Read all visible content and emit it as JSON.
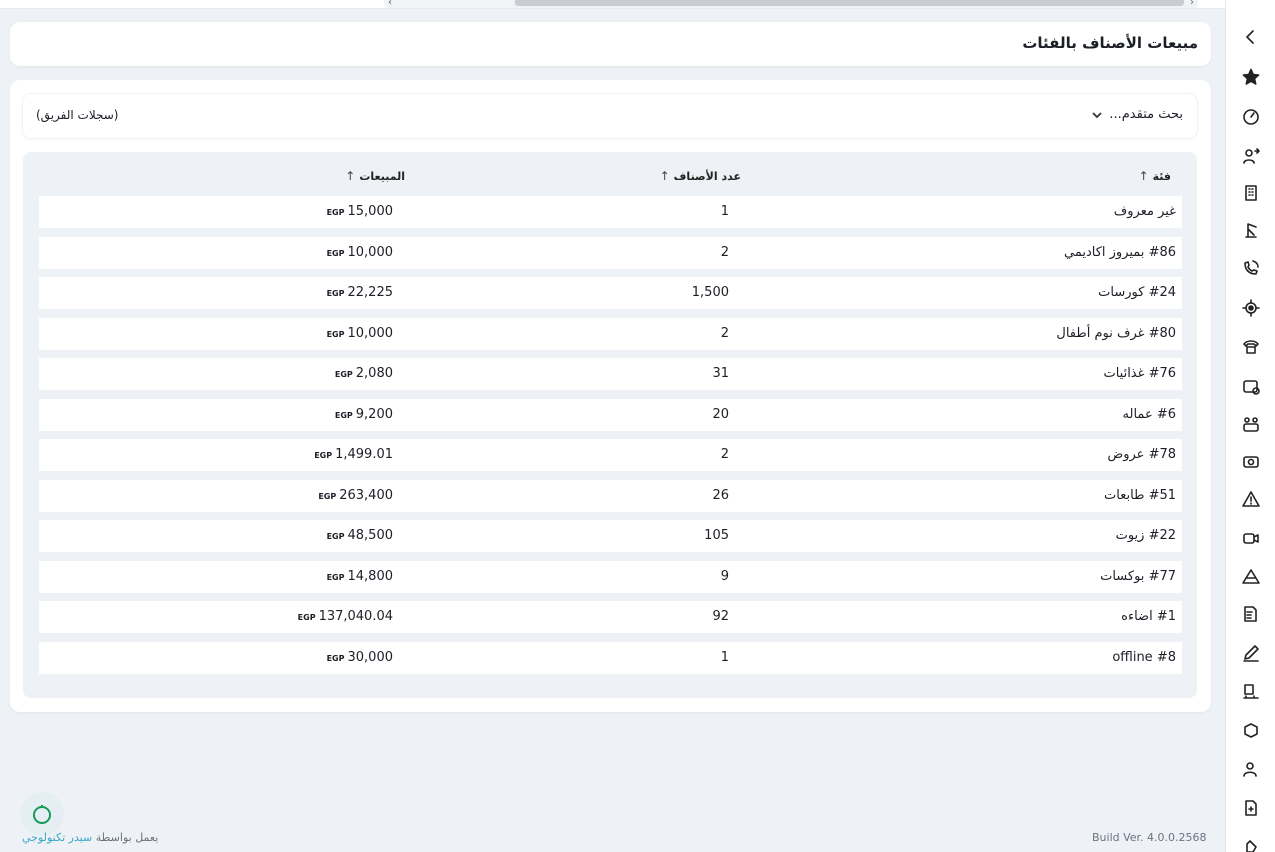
{
  "page": {
    "title": "مبيعات الأصناف بالفئات"
  },
  "search": {
    "advanced_label": "بحث متقدم...",
    "team_records_label": "(سجلات الفريق)"
  },
  "table": {
    "columns": {
      "category": "فئة",
      "count": "عدد الأصناف",
      "sales": "المبيعات"
    },
    "currency": "EGP",
    "rows": [
      {
        "category": "غير معروف",
        "count": "1",
        "sales": "15,000"
      },
      {
        "category": "#86 بميروز اكاديمي",
        "count": "2",
        "sales": "10,000"
      },
      {
        "category": "#24 كورسات",
        "count": "1,500",
        "sales": "22,225"
      },
      {
        "category": "#80 غرف نوم أطفال",
        "count": "2",
        "sales": "10,000"
      },
      {
        "category": "#76 غذائيات",
        "count": "31",
        "sales": "2,080"
      },
      {
        "category": "#6 عماله",
        "count": "20",
        "sales": "9,200"
      },
      {
        "category": "#78 عروض",
        "count": "2",
        "sales": "1,499.01"
      },
      {
        "category": "#51 طابعات",
        "count": "26",
        "sales": "263,400"
      },
      {
        "category": "#22 زيوت",
        "count": "105",
        "sales": "48,500"
      },
      {
        "category": "#77 بوكسات",
        "count": "9",
        "sales": "14,800"
      },
      {
        "category": "#1 اضاءه",
        "count": "92",
        "sales": "137,040.04"
      },
      {
        "category": "#8 offline",
        "count": "1",
        "sales": "30,000"
      }
    ]
  },
  "footer": {
    "powered_by": "يعمل بواسطة",
    "brand": "سيدر تكنولوجي",
    "build": "Build Ver. 4.0.0.2568"
  },
  "sidebar": {
    "icons": [
      "chevron-left-icon",
      "star-icon",
      "speedometer-icon",
      "users-exchange-icon",
      "building-icon",
      "crane-icon",
      "phone-call-icon",
      "location-target-icon",
      "telephone-icon",
      "card-add-icon",
      "team-icon",
      "money-icon",
      "warning-icon",
      "video-icon",
      "mountain-icon",
      "invoice-dollar-icon",
      "pen-icon",
      "truck-box-icon",
      "cube-truck-icon",
      "user-phone-icon",
      "document-add-icon",
      "hand-icon"
    ]
  },
  "colors": {
    "background": "#eef2f6",
    "brand": "#3aa7c9",
    "fab": "#1a9a5a"
  }
}
